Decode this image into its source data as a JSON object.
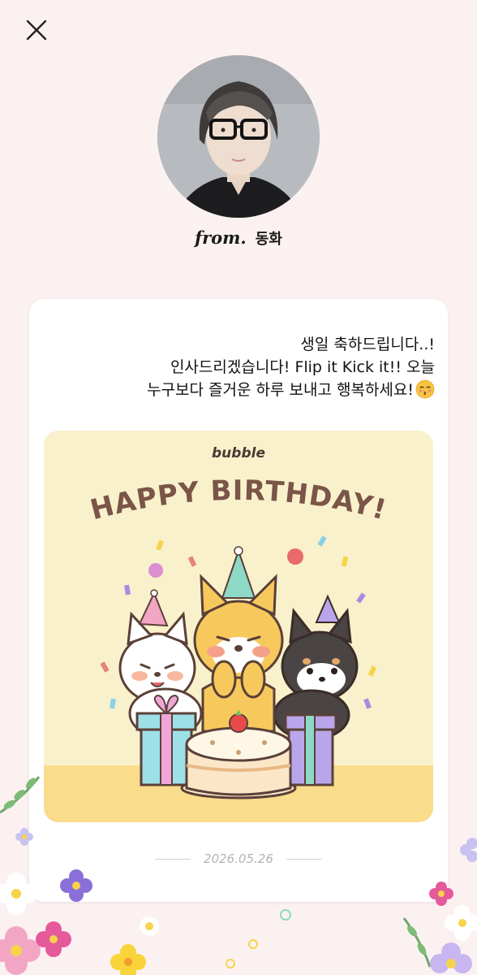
{
  "header": {
    "close_icon": "close-icon"
  },
  "sender": {
    "from_script": "from.",
    "name": "동화"
  },
  "message": {
    "lines": [
      "생일 축하드립니다..!",
      "인사드리겠습니다! Flip it Kick it!! 오늘",
      "누구보다 즐거운 하루 보내고 행복하세요!"
    ],
    "emoji_icon": "kissing-face-emoji-icon"
  },
  "card_image": {
    "brand": "bubble",
    "headline": "HAPPY BIRTHDAY!"
  },
  "date": "2026.05.26",
  "colors": {
    "background": "#fcf1f1",
    "card": "#ffffff",
    "banner_bg": "#f9f1cc",
    "headline": "#7a5548",
    "date_text": "#b4b4b4"
  }
}
